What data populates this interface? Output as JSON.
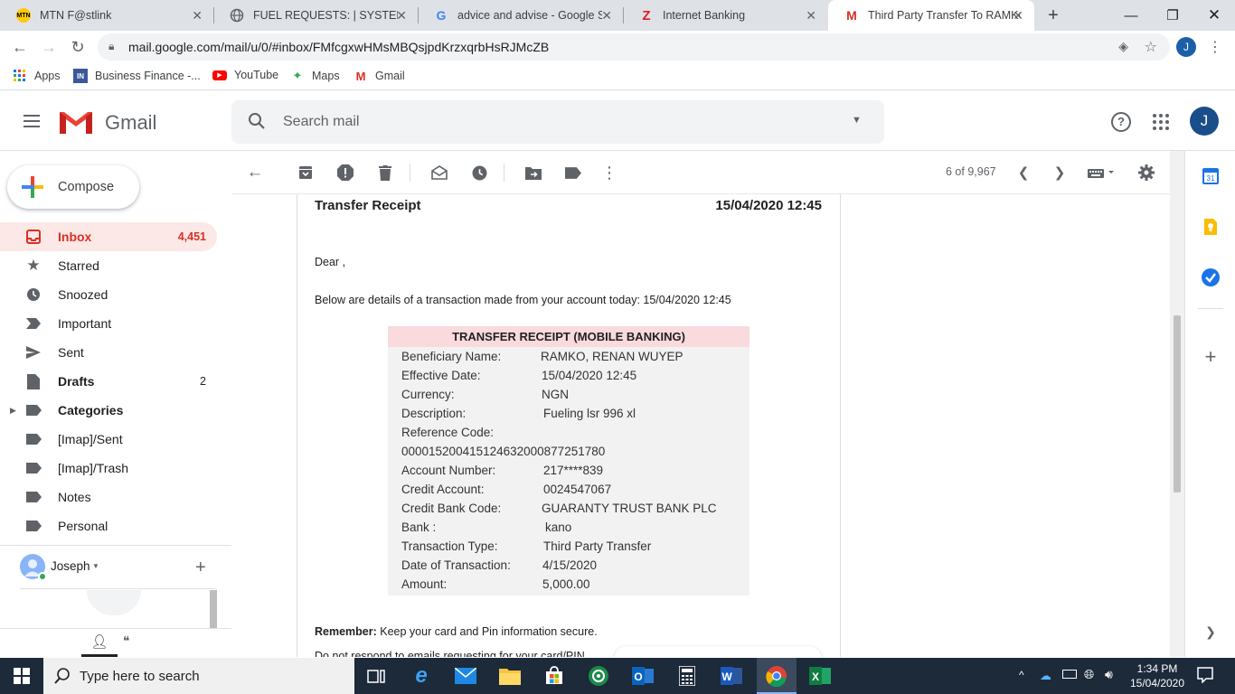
{
  "browser": {
    "tabs": [
      {
        "title": "MTN F@stlink",
        "icon": "mtn-icon"
      },
      {
        "title": "FUEL REQUESTS: | SYSTEM MA",
        "icon": "globe-icon"
      },
      {
        "title": "advice and advise - Google Se",
        "icon": "google-icon"
      },
      {
        "title": "Internet Banking",
        "icon": "zenith-icon"
      },
      {
        "title": "Third Party Transfer To RAMKO",
        "icon": "gmail-icon"
      }
    ],
    "url": "mail.google.com/mail/u/0/#inbox/FMfcgxwHMsMBQsjpdKrzxqrbHsRJMcZB",
    "profile_initial": "J",
    "bookmarks": [
      {
        "label": "Apps"
      },
      {
        "label": "Business Finance -..."
      },
      {
        "label": "YouTube"
      },
      {
        "label": "Maps"
      },
      {
        "label": "Gmail"
      }
    ]
  },
  "gmail": {
    "brand": "Gmail",
    "search_placeholder": "Search mail",
    "avatar_initial": "J",
    "compose_label": "Compose",
    "nav": [
      {
        "label": "Inbox",
        "count": "4,451"
      },
      {
        "label": "Starred",
        "count": ""
      },
      {
        "label": "Snoozed",
        "count": ""
      },
      {
        "label": "Important",
        "count": ""
      },
      {
        "label": "Sent",
        "count": ""
      },
      {
        "label": "Drafts",
        "count": "2"
      },
      {
        "label": "Categories",
        "count": ""
      },
      {
        "label": "[Imap]/Sent",
        "count": ""
      },
      {
        "label": "[Imap]/Trash",
        "count": ""
      },
      {
        "label": "Notes",
        "count": ""
      },
      {
        "label": "Personal",
        "count": ""
      }
    ],
    "hangouts_user": "Joseph",
    "pagination": "6 of 9,967"
  },
  "email": {
    "title": "Transfer Receipt",
    "datetime": "15/04/2020 12:45",
    "greeting": "Dear ,",
    "intro": "Below are details of a transaction made from your account today: 15/04/2020 12:45",
    "receipt_header": "TRANSFER RECEIPT (MOBILE BANKING)",
    "rows": [
      {
        "label": "Beneficiary Name:",
        "value": "RAMKO, RENAN WUYEP"
      },
      {
        "label": "Effective Date:",
        "value": "15/04/2020 12:45"
      },
      {
        "label": "Currency:",
        "value": "NGN"
      },
      {
        "label": "Description:",
        "value": "Fueling lsr 996 xl"
      },
      {
        "label": "Reference Code:",
        "value": ""
      },
      {
        "label": "000015200415124632000877251780",
        "value": ""
      },
      {
        "label": "Account Number:",
        "value": "217****839"
      },
      {
        "label": "Credit Account:",
        "value": "0024547067"
      },
      {
        "label": "Credit Bank Code:",
        "value": "GUARANTY TRUST BANK PLC"
      },
      {
        "label": "Bank :",
        "value": "kano"
      },
      {
        "label": "Transaction Type:",
        "value": "Third Party Transfer"
      },
      {
        "label": "Date of Transaction:",
        "value": "4/15/2020"
      },
      {
        "label": "Amount:",
        "value": "5,000.00"
      }
    ],
    "remember_label": "Remember:",
    "remember_text": "Keep your card and Pin information secure.",
    "footer_cut": "Do not respond to emails requesting for your card/PIN"
  },
  "taskbar": {
    "search_placeholder": "Type here to search",
    "time": "1:34 PM",
    "date": "15/04/2020"
  },
  "colors": {
    "inbox_active_bg": "#fce8e6",
    "inbox_active_text": "#d93025",
    "receipt_header_bg": "#fadadd",
    "taskbar_bg": "#1c2a3a"
  }
}
